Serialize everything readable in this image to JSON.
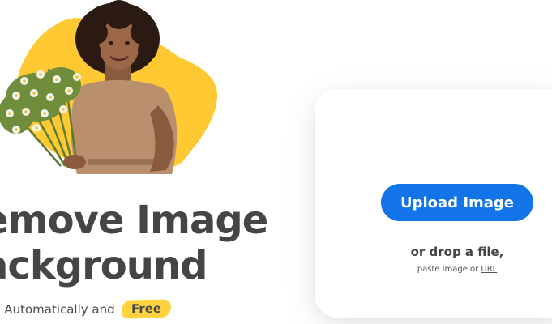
{
  "hero": {
    "title_line1": "emove Image",
    "title_line2": "ackground",
    "subtitle": "6 Automatically and",
    "badge": "Free"
  },
  "upload": {
    "button_label": "Upload Image",
    "drop_text": "or drop a file,",
    "paste_prefix": "paste image or ",
    "url_link": "URL"
  },
  "colors": {
    "accent_blue": "#1274e8",
    "badge_yellow": "#ffd23f",
    "blob_yellow": "#ffc933",
    "text_dark": "#454545"
  },
  "icons": {
    "hero_image": "woman-holding-flowers-illustration"
  }
}
